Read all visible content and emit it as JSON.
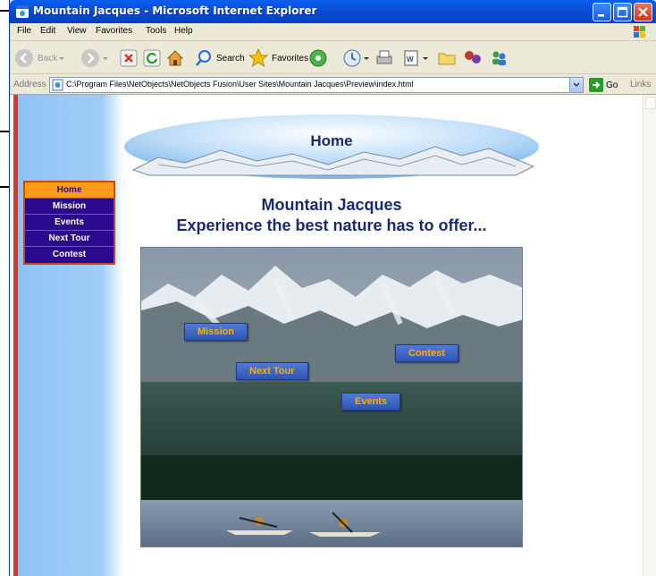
{
  "window": {
    "title": "Mountain Jacques - Microsoft Internet Explorer"
  },
  "menubar": {
    "items": [
      "File",
      "Edit",
      "View",
      "Favorites",
      "Tools",
      "Help"
    ]
  },
  "toolbar": {
    "back_label": "Back",
    "search_label": "Search",
    "favorites_label": "Favorites"
  },
  "addressbar": {
    "label": "Address",
    "value": "C:\\Program Files\\NetObjects\\NetObjects Fusion\\User Sites\\Mountain Jacques\\Preview\\index.html",
    "go_label": "Go",
    "links_label": "Links"
  },
  "page": {
    "banner_title": "Home",
    "nav": [
      "Home",
      "Mission",
      "Events",
      "Next Tour",
      "Contest"
    ],
    "headline_line1": "Mountain Jacques",
    "headline_line2": "Experience the best nature has to offer...",
    "photo_buttons": {
      "mission": "Mission",
      "next_tour": "Next Tour",
      "contest": "Contest",
      "events": "Events"
    }
  },
  "colors": {
    "title_bar": "#0a4fd6",
    "nav_bg": "#2a0a8c",
    "nav_active": "#ff9a1a",
    "heading_text": "#1b2a6e",
    "side_band": "#9fcdf7"
  }
}
